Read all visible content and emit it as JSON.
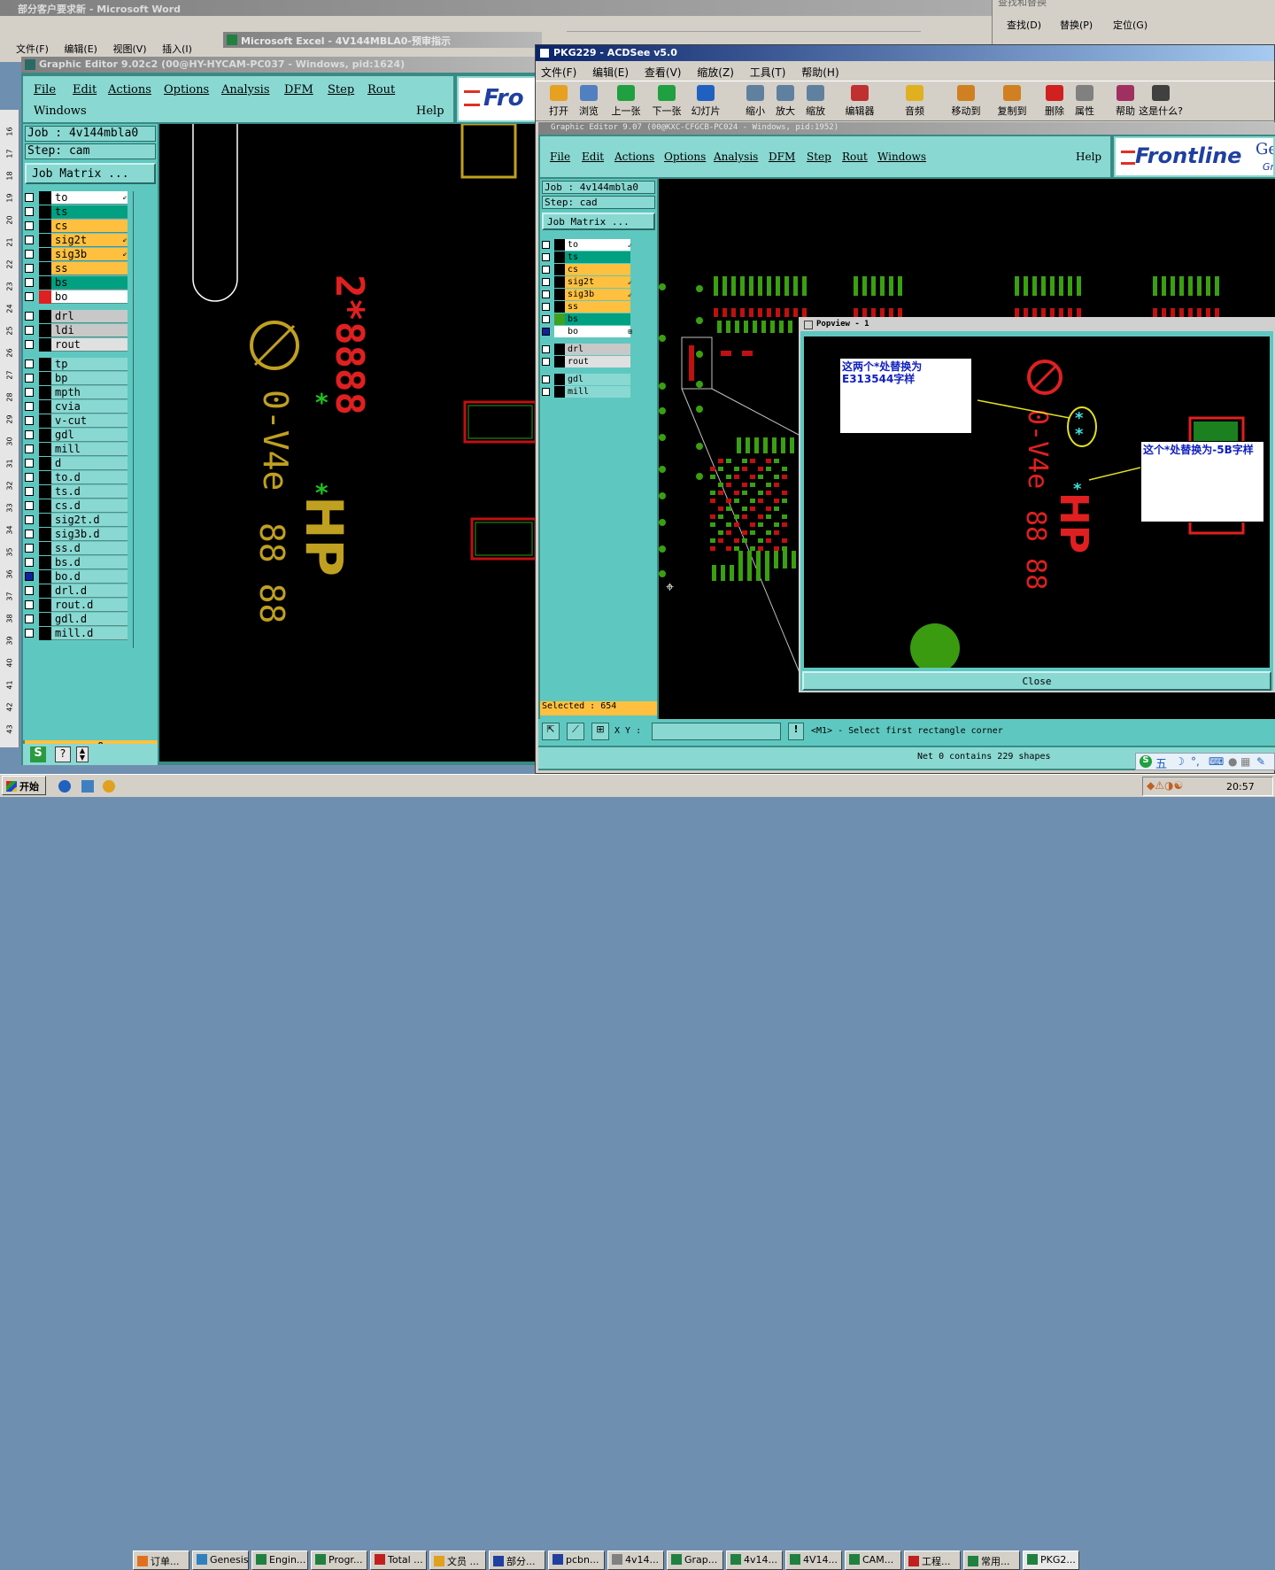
{
  "word": {
    "title": "部分客户要求新 - Microsoft Word",
    "menu": [
      "文件(F)",
      "编辑(E)",
      "视图(V)",
      "插入(I)"
    ],
    "find": [
      "查找(D)",
      "替换(P)",
      "定位(G)"
    ],
    "find_title": "查找和替换"
  },
  "excel": {
    "title": "Microsoft Excel - 4V144MBLA0-预审指示"
  },
  "ge_left": {
    "title": "Graphic Editor 9.02c2 (00@HY-HYCAM-PC037 - Windows, pid:1624)",
    "menu": [
      "File",
      "Edit",
      "Actions",
      "Options",
      "Analysis",
      "DFM",
      "Step",
      "Rout"
    ],
    "menu2_left": "Windows",
    "menu2_right": "Help",
    "logo": "Fro",
    "job": "Job : 4v144mbla0",
    "step": "Step: cam",
    "job_matrix": "Job Matrix ...",
    "layers_a": [
      {
        "name": "to",
        "color": "#ffffff",
        "mark": "⇙"
      },
      {
        "name": "ts",
        "color": "#00a080",
        "mark": ""
      },
      {
        "name": "cs",
        "color": "#ffc040",
        "mark": ""
      },
      {
        "name": "sig2t",
        "color": "#ffc040",
        "mark": "⇙"
      },
      {
        "name": "sig3b",
        "color": "#ffc040",
        "mark": "⇙"
      },
      {
        "name": "ss",
        "color": "#ffc040",
        "mark": ""
      },
      {
        "name": "bs",
        "color": "#00a080",
        "mark": ""
      },
      {
        "name": "bo",
        "color": "#ffffff",
        "mark": ""
      }
    ],
    "layers_b": [
      {
        "name": "drl",
        "color": "#c8c8c8"
      },
      {
        "name": "ldi",
        "color": "#c8c8c8"
      },
      {
        "name": "rout",
        "color": "#e0e0e0"
      }
    ],
    "layers_c": [
      "tp",
      "bp",
      "mpth",
      "cvia",
      "v-cut",
      "gdl",
      "mill",
      "d",
      "to.d",
      "ts.d",
      "cs.d",
      "sig2t.d",
      "sig3b.d",
      "ss.d",
      "bs.d",
      "bo.d",
      "drl.d",
      "rout.d",
      "gdl.d",
      "mill.d"
    ],
    "layers_c_marks": {
      "to.d": "⇙",
      "sig2t.d": "⇙",
      "sig3b.d": "⇙",
      "bo.d": "⊞"
    },
    "count": "0",
    "ruler": [
      "16",
      "17",
      "18",
      "19",
      "20",
      "21",
      "22",
      "23",
      "24",
      "25",
      "26",
      "27",
      "28",
      "29",
      "30",
      "31",
      "32",
      "33",
      "34",
      "35",
      "36",
      "37",
      "38",
      "39",
      "40",
      "41",
      "42",
      "43"
    ],
    "canvas_text": {
      "code1": "0-V4e",
      "code2": "88 88",
      "code3": "HP",
      "code4": "2*8888"
    }
  },
  "acdsee": {
    "title": "PKG229 - ACDSee v5.0",
    "menu": [
      "文件(F)",
      "编辑(E)",
      "查看(V)",
      "缩放(Z)",
      "工具(T)",
      "帮助(H)"
    ],
    "toolbar": [
      {
        "label": "打开",
        "icon": "folder-open-icon",
        "color": "#e8a020"
      },
      {
        "label": "浏览",
        "icon": "browse-icon",
        "color": "#5080c0"
      },
      {
        "label": "上一张",
        "icon": "prev-icon",
        "color": "#20a040"
      },
      {
        "label": "下一张",
        "icon": "next-icon",
        "color": "#20a040"
      },
      {
        "label": "幻灯片",
        "icon": "slideshow-icon",
        "color": "#2060c0"
      },
      {
        "label": "缩小",
        "icon": "zoom-out-icon",
        "color": "#6080a0"
      },
      {
        "label": "放大",
        "icon": "zoom-in-icon",
        "color": "#6080a0"
      },
      {
        "label": "缩放",
        "icon": "zoom-icon",
        "color": "#6080a0"
      },
      {
        "label": "编辑器",
        "icon": "editor-icon",
        "color": "#c03030"
      },
      {
        "label": "音频",
        "icon": "audio-icon",
        "color": "#e0b020"
      },
      {
        "label": "移动到",
        "icon": "move-icon",
        "color": "#d08020"
      },
      {
        "label": "复制到",
        "icon": "copy-icon",
        "color": "#d08020"
      },
      {
        "label": "删除",
        "icon": "delete-icon",
        "color": "#d02020"
      },
      {
        "label": "属性",
        "icon": "properties-icon",
        "color": "#808080"
      },
      {
        "label": "帮助",
        "icon": "help-book-icon",
        "color": "#a03060"
      },
      {
        "label": "这是什么?",
        "icon": "whats-this-icon",
        "color": "#404040"
      }
    ]
  },
  "ge_right": {
    "title": "Graphic Editor 9.07 (00@KXC-CFGCB-PC024 - Windows, pid:1952)",
    "menu": [
      "File",
      "Edit",
      "Actions",
      "Options",
      "Analysis",
      "DFM",
      "Step",
      "Rout",
      "Windows"
    ],
    "help": "Help",
    "logo": "Frontline",
    "logo_side": "Gen",
    "logo_side2": "Gr",
    "job": "Job : 4v144mbla0",
    "step": "Step: cad",
    "job_matrix": "Job Matrix ...",
    "layers_a": [
      {
        "name": "to",
        "color": "#ffffff",
        "mark": "⇙"
      },
      {
        "name": "ts",
        "color": "#00a080",
        "mark": ""
      },
      {
        "name": "cs",
        "color": "#ffc040",
        "mark": ""
      },
      {
        "name": "sig2t",
        "color": "#ffc040",
        "mark": "⇙"
      },
      {
        "name": "sig3b",
        "color": "#ffc040",
        "mark": "⇙"
      },
      {
        "name": "ss",
        "color": "#ffc040",
        "mark": ""
      },
      {
        "name": "bs",
        "color": "#00a080",
        "mark": ""
      },
      {
        "name": "bo",
        "color": "#ffffff",
        "mark": "⊞"
      }
    ],
    "layers_b": [
      {
        "name": "drl",
        "color": "#c8c8c8"
      },
      {
        "name": "rout",
        "color": "#e0e0e0"
      }
    ],
    "layers_c": [
      "gdl",
      "mill"
    ],
    "selected": "Selected : 654",
    "xy_label": "X Y :",
    "xy_value": "",
    "prompt": "<M1> - Select first rectangle corner",
    "net": "Net 0 contains 229 shapes"
  },
  "popview": {
    "title": "Popview - 1",
    "note1": "这两个*处替换为E313544字样",
    "note2": "这个*处替换为-5B字样",
    "close": "Close"
  },
  "ime": {
    "label": "五"
  },
  "taskbar": {
    "start": "开始",
    "time": "20:57",
    "items": [
      {
        "label": "订单...",
        "color": "#e07020"
      },
      {
        "label": "Genesis",
        "color": "#3080c0"
      },
      {
        "label": "Engin...",
        "color": "#208040"
      },
      {
        "label": "Progr...",
        "color": "#208040"
      },
      {
        "label": "Total ...",
        "color": "#c02020"
      },
      {
        "label": "文员 ...",
        "color": "#e0a020"
      },
      {
        "label": "部分...",
        "color": "#2040a0"
      },
      {
        "label": "pcbn...",
        "color": "#2040a0"
      },
      {
        "label": "4v14...",
        "color": "#808080"
      },
      {
        "label": "Grap...",
        "color": "#208040"
      },
      {
        "label": "4v14...",
        "color": "#208040"
      },
      {
        "label": "4V14...",
        "color": "#208040"
      },
      {
        "label": "CAM...",
        "color": "#208040"
      },
      {
        "label": "工程...",
        "color": "#c02020"
      },
      {
        "label": "常用...",
        "color": "#208040"
      },
      {
        "label": "PKG2...",
        "color": "#208040"
      }
    ]
  }
}
